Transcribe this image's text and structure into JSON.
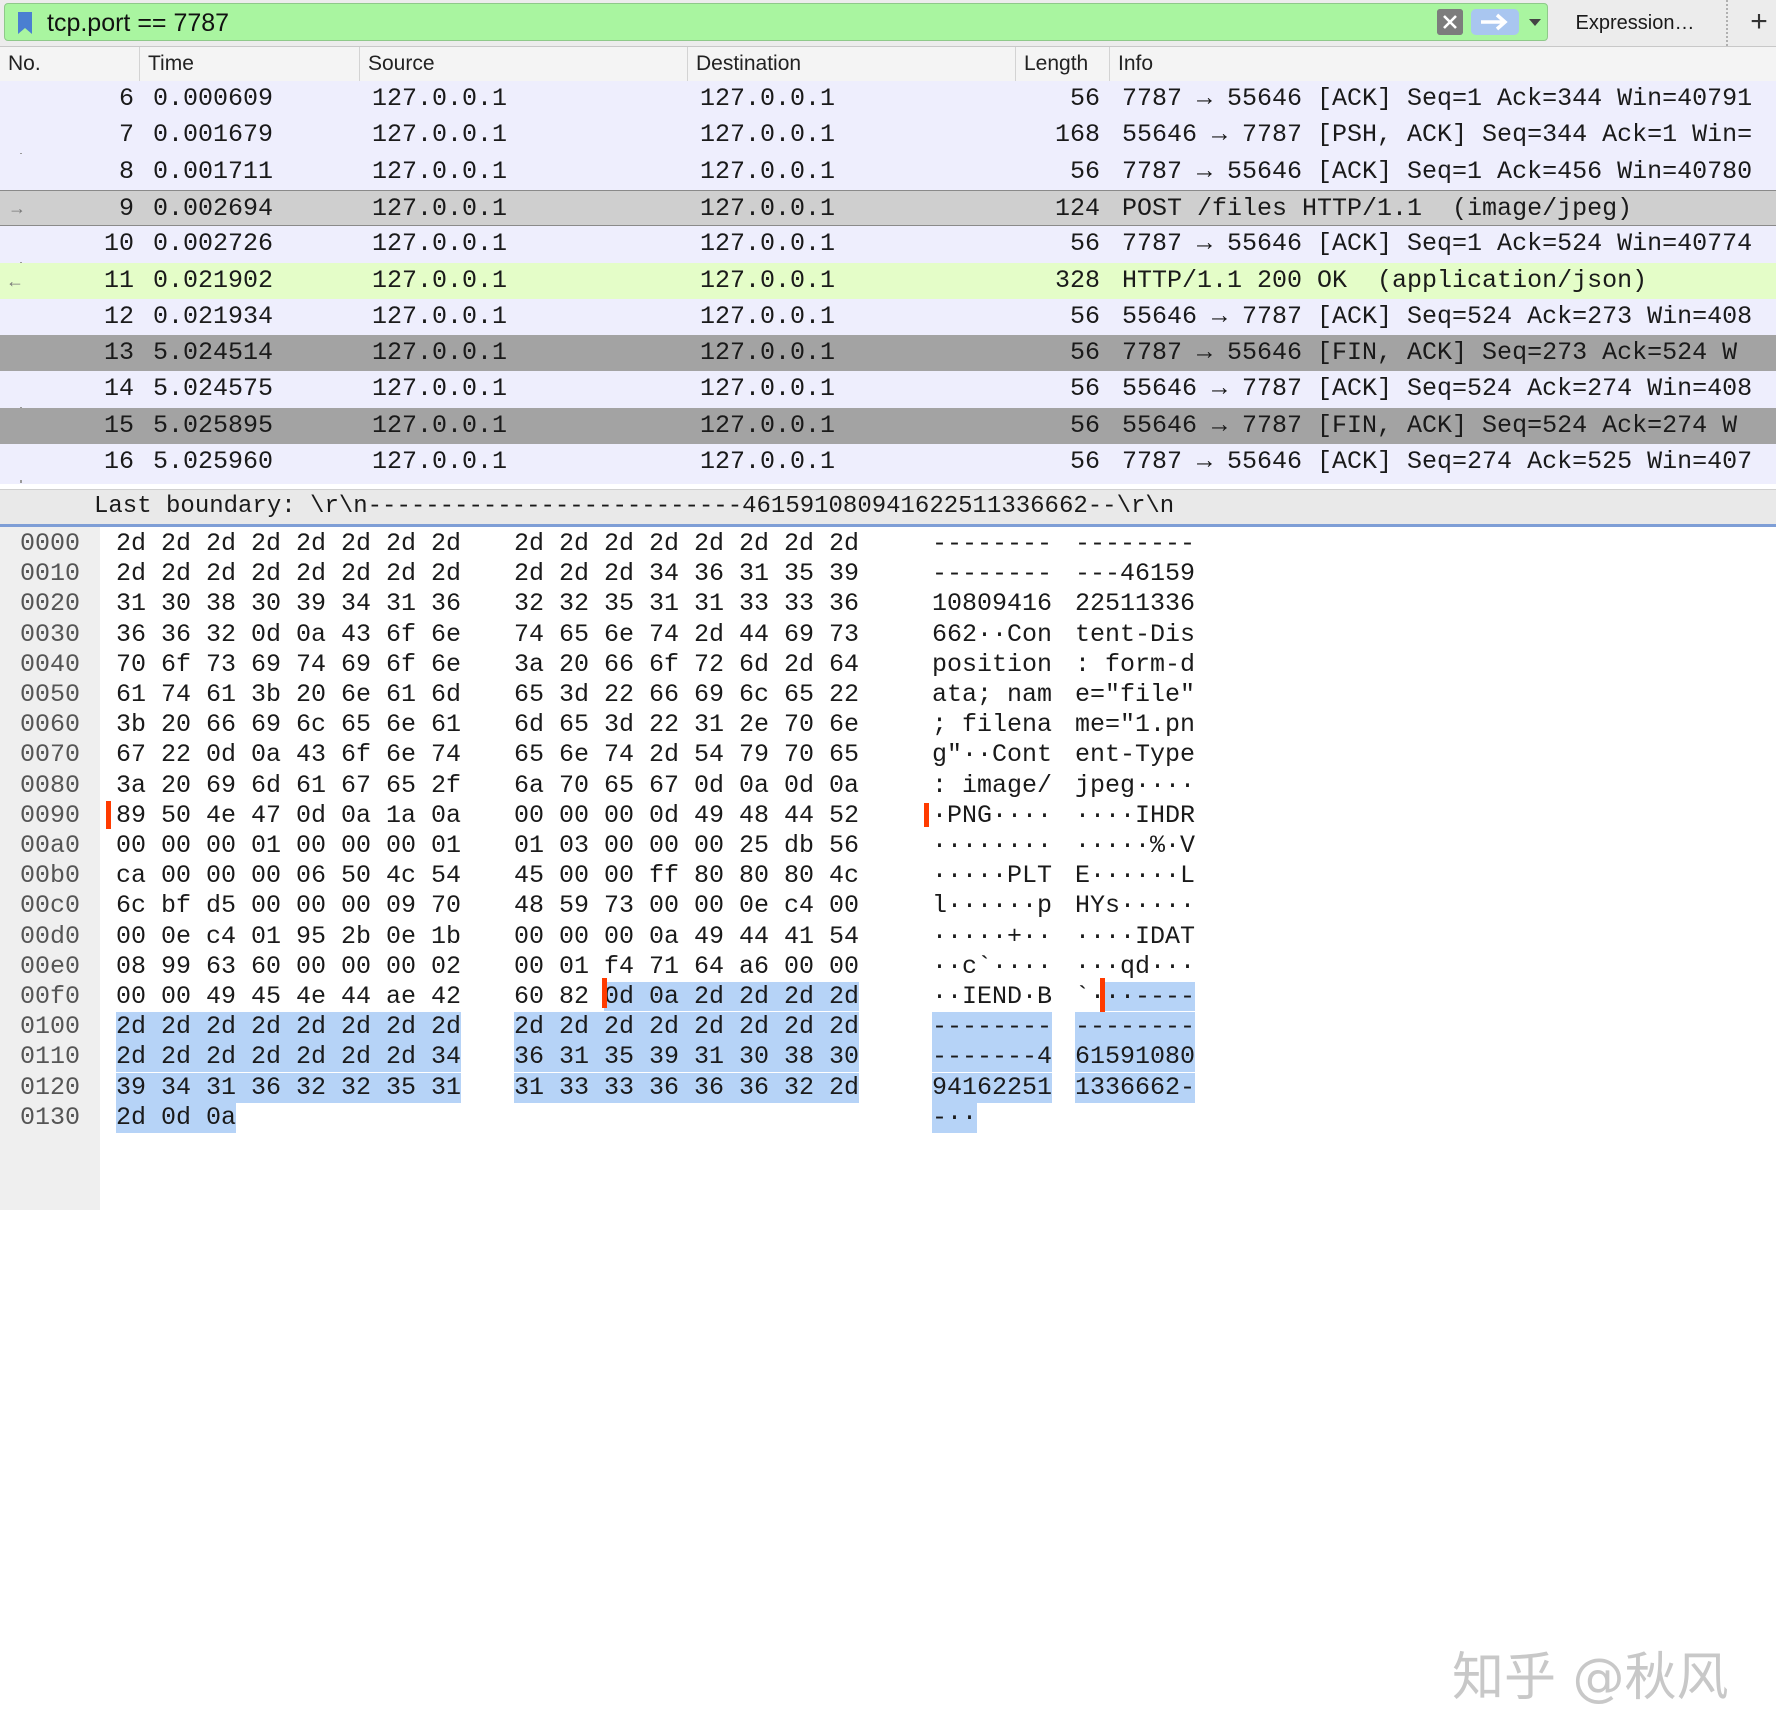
{
  "filter": {
    "value": "tcp.port == 7787",
    "expression_label": "Expression…",
    "add_label": "+"
  },
  "columns": [
    "No.",
    "Time",
    "Source",
    "Destination",
    "Length",
    "Info"
  ],
  "packets": [
    {
      "no": "6",
      "time": "0.000609",
      "src": "127.0.0.1",
      "dst": "127.0.0.1",
      "len": "56",
      "info": "7787 → 55646 [ACK] Seq=1 Ack=344 Win=40791",
      "style": "normal"
    },
    {
      "no": "7",
      "time": "0.001679",
      "src": "127.0.0.1",
      "dst": "127.0.0.1",
      "len": "168",
      "info": "55646 → 7787 [PSH, ACK] Seq=344 Ack=1 Win=",
      "style": "normal"
    },
    {
      "no": "8",
      "time": "0.001711",
      "src": "127.0.0.1",
      "dst": "127.0.0.1",
      "len": "56",
      "info": "7787 → 55646 [ACK] Seq=1 Ack=456 Win=40780",
      "style": "normal"
    },
    {
      "no": "9",
      "time": "0.002694",
      "src": "127.0.0.1",
      "dst": "127.0.0.1",
      "len": "124",
      "info": "POST /files HTTP/1.1  (image/jpeg)",
      "style": "selected"
    },
    {
      "no": "10",
      "time": "0.002726",
      "src": "127.0.0.1",
      "dst": "127.0.0.1",
      "len": "56",
      "info": "7787 → 55646 [ACK] Seq=1 Ack=524 Win=40774",
      "style": "normal"
    },
    {
      "no": "11",
      "time": "0.021902",
      "src": "127.0.0.1",
      "dst": "127.0.0.1",
      "len": "328",
      "info": "HTTP/1.1 200 OK  (application/json)",
      "style": "http"
    },
    {
      "no": "12",
      "time": "0.021934",
      "src": "127.0.0.1",
      "dst": "127.0.0.1",
      "len": "56",
      "info": "55646 → 7787 [ACK] Seq=524 Ack=273 Win=408",
      "style": "normal"
    },
    {
      "no": "13",
      "time": "5.024514",
      "src": "127.0.0.1",
      "dst": "127.0.0.1",
      "len": "56",
      "info": "7787 → 55646 [FIN, ACK] Seq=273 Ack=524 W",
      "style": "fin"
    },
    {
      "no": "14",
      "time": "5.024575",
      "src": "127.0.0.1",
      "dst": "127.0.0.1",
      "len": "56",
      "info": "55646 → 7787 [ACK] Seq=524 Ack=274 Win=408",
      "style": "normal"
    },
    {
      "no": "15",
      "time": "5.025895",
      "src": "127.0.0.1",
      "dst": "127.0.0.1",
      "len": "56",
      "info": "55646 → 7787 [FIN, ACK] Seq=524 Ack=274 W",
      "style": "fin"
    },
    {
      "no": "16",
      "time": "5.025960",
      "src": "127.0.0.1",
      "dst": "127.0.0.1",
      "len": "56",
      "info": "7787 → 55646 [ACK] Seq=274 Ack=525 Win=407",
      "style": "normal"
    }
  ],
  "detail_line": "Last boundary: \\r\\n--------------------------461591080941622511336662--\\r\\n",
  "bytes": [
    {
      "off": "0000",
      "hex1": "2d 2d 2d 2d 2d 2d 2d 2d",
      "hex2": "2d 2d 2d 2d 2d 2d 2d 2d",
      "asc1": "--------",
      "asc2": "--------"
    },
    {
      "off": "0010",
      "hex1": "2d 2d 2d 2d 2d 2d 2d 2d",
      "hex2": "2d 2d 2d 34 36 31 35 39",
      "asc1": "--------",
      "asc2": "---46159"
    },
    {
      "off": "0020",
      "hex1": "31 30 38 30 39 34 31 36",
      "hex2": "32 32 35 31 31 33 33 36",
      "asc1": "10809416",
      "asc2": "22511336"
    },
    {
      "off": "0030",
      "hex1": "36 36 32 0d 0a 43 6f 6e",
      "hex2": "74 65 6e 74 2d 44 69 73",
      "asc1": "662··Con",
      "asc2": "tent-Dis"
    },
    {
      "off": "0040",
      "hex1": "70 6f 73 69 74 69 6f 6e",
      "hex2": "3a 20 66 6f 72 6d 2d 64",
      "asc1": "position",
      "asc2": ": form-d"
    },
    {
      "off": "0050",
      "hex1": "61 74 61 3b 20 6e 61 6d",
      "hex2": "65 3d 22 66 69 6c 65 22",
      "asc1": "ata; nam",
      "asc2": "e=\"file\""
    },
    {
      "off": "0060",
      "hex1": "3b 20 66 69 6c 65 6e 61",
      "hex2": "6d 65 3d 22 31 2e 70 6e",
      "asc1": "; filena",
      "asc2": "me=\"1.pn"
    },
    {
      "off": "0070",
      "hex1": "67 22 0d 0a 43 6f 6e 74",
      "hex2": "65 6e 74 2d 54 79 70 65",
      "asc1": "g\"··Cont",
      "asc2": "ent-Type"
    },
    {
      "off": "0080",
      "hex1": "3a 20 69 6d 61 67 65 2f",
      "hex2": "6a 70 65 67 0d 0a 0d 0a",
      "asc1": ": image/",
      "asc2": "jpeg····"
    },
    {
      "off": "0090",
      "hex1": "89 50 4e 47 0d 0a 1a 0a",
      "hex2": "00 00 00 0d 49 48 44 52",
      "asc1": "·PNG····",
      "asc2": "····IHDR"
    },
    {
      "off": "00a0",
      "hex1": "00 00 00 01 00 00 00 01",
      "hex2": "01 03 00 00 00 25 db 56",
      "asc1": "········",
      "asc2": "·····%·V"
    },
    {
      "off": "00b0",
      "hex1": "ca 00 00 00 06 50 4c 54",
      "hex2": "45 00 00 ff 80 80 80 4c",
      "asc1": "·····PLT",
      "asc2": "E······L"
    },
    {
      "off": "00c0",
      "hex1": "6c bf d5 00 00 00 09 70",
      "hex2": "48 59 73 00 00 0e c4 00",
      "asc1": "l······p",
      "asc2": "HYs·····"
    },
    {
      "off": "00d0",
      "hex1": "00 0e c4 01 95 2b 0e 1b",
      "hex2": "00 00 00 0a 49 44 41 54",
      "asc1": "·····+··",
      "asc2": "····IDAT"
    },
    {
      "off": "00e0",
      "hex1": "08 99 63 60 00 00 00 02",
      "hex2": "00 01 f4 71 64 a6 00 00",
      "asc1": "··c`····",
      "asc2": "···qd···"
    },
    {
      "off": "00f0",
      "hex1": "00 00 49 45 4e 44 ae 42",
      "hex2": "60 82 0d 0a 2d 2d 2d 2d",
      "asc1": "··IEND·B",
      "asc2": "`···----"
    },
    {
      "off": "0100",
      "hex1": "2d 2d 2d 2d 2d 2d 2d 2d",
      "hex2": "2d 2d 2d 2d 2d 2d 2d 2d",
      "asc1": "--------",
      "asc2": "--------"
    },
    {
      "off": "0110",
      "hex1": "2d 2d 2d 2d 2d 2d 2d 34",
      "hex2": "36 31 35 39 31 30 38 30",
      "asc1": "-------4",
      "asc2": "61591080"
    },
    {
      "off": "0120",
      "hex1": "39 34 31 36 32 32 35 31",
      "hex2": "31 33 33 36 36 36 32 2d",
      "asc1": "94162251",
      "asc2": "1336662-"
    },
    {
      "off": "0130",
      "hex1": "2d 0d 0a",
      "hex2": "",
      "asc1": "-··",
      "asc2": ""
    }
  ],
  "watermark": "知乎 @秋风",
  "colors": {
    "filter_bg": "#a9f5a0",
    "row_normal": "#eeeefd",
    "row_selected": "#cfcfcf",
    "row_http": "#e4fdc8",
    "row_fin": "#a3a3a3",
    "byte_highlight": "#b6d3f7",
    "marker": "#ff3b00"
  }
}
